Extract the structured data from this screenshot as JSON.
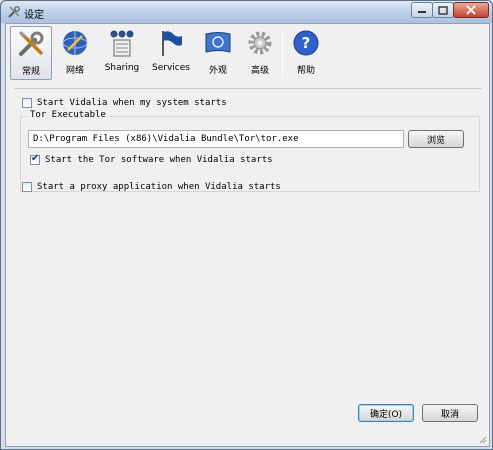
{
  "window": {
    "title": "设定"
  },
  "toolbar": {
    "items": [
      {
        "label": "常规",
        "icon": "tools-icon"
      },
      {
        "label": "网络",
        "icon": "network-icon"
      },
      {
        "label": "Sharing",
        "icon": "sharing-icon"
      },
      {
        "label": "Services",
        "icon": "services-icon"
      },
      {
        "label": "外观",
        "icon": "appearance-icon"
      },
      {
        "label": "高级",
        "icon": "advanced-icon"
      },
      {
        "label": "帮助",
        "icon": "help-icon"
      }
    ],
    "active_index": 0
  },
  "general": {
    "start_vidalia_label": "Start Vidalia when my system starts",
    "start_vidalia_checked": false,
    "tor_group_title": "Tor Executable",
    "tor_path": "D:\\Program Files (x86)\\Vidalia Bundle\\Tor\\tor.exe",
    "browse_label": "浏览",
    "start_tor_label": "Start the Tor software when Vidalia starts",
    "start_tor_checked": true,
    "proxy_label": "Start a proxy application when Vidalia starts",
    "proxy_checked": false
  },
  "footer": {
    "ok_label": "确定(O)",
    "cancel_label": "取消"
  },
  "colors": {
    "accent": "#3c7fb1",
    "frame": "#b8cbe3",
    "background": "#f0f0f0"
  }
}
